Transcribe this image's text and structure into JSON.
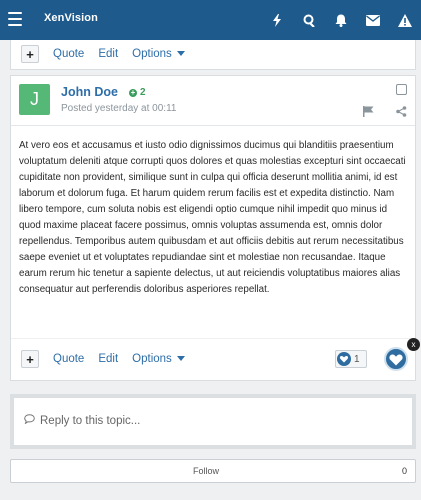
{
  "navbar": {
    "brand_part1": "Xen",
    "brand_part2": "Vision",
    "icons": [
      "bolt-icon",
      "search-icon",
      "bell-icon",
      "envelope-icon",
      "warning-icon"
    ],
    "color": "#1e5a8c"
  },
  "post_actions_top": {
    "quote_label": "Quote",
    "edit_label": "Edit",
    "options_label": "Options"
  },
  "post": {
    "avatar_letter": "J",
    "avatar_color": "#55b877",
    "username": "John Doe",
    "reputation": "2",
    "posted_prefix": "Posted",
    "posted_time": "yesterday at 00:11",
    "body": "At vero eos et accusamus et iusto odio dignissimos ducimus qui blanditiis praesentium voluptatum deleniti atque corrupti quos dolores et quas molestias excepturi sint occaecati cupiditate non provident, similique sunt in culpa qui officia deserunt mollitia animi, id est laborum et dolorum fuga. Et harum quidem rerum facilis est et expedita distinctio. Nam libero tempore, cum soluta nobis est eligendi optio cumque nihil impedit quo minus id quod maxime placeat facere possimus, omnis voluptas assumenda est, omnis dolor repellendus. Temporibus autem quibusdam et aut officiis debitis aut rerum necessitatibus saepe eveniet ut et voluptates repudiandae sint et molestiae non recusandae. Itaque earum rerum hic tenetur a sapiente delectus, ut aut reiciendis voluptatibus maiores alias consequatur aut perferendis doloribus asperiores repellat.",
    "actions": {
      "quote_label": "Quote",
      "edit_label": "Edit",
      "options_label": "Options"
    },
    "reaction_count": "1",
    "like_close": "x"
  },
  "reply": {
    "placeholder": "Reply to this topic..."
  },
  "follow": {
    "label": "Follow",
    "count": "0"
  }
}
